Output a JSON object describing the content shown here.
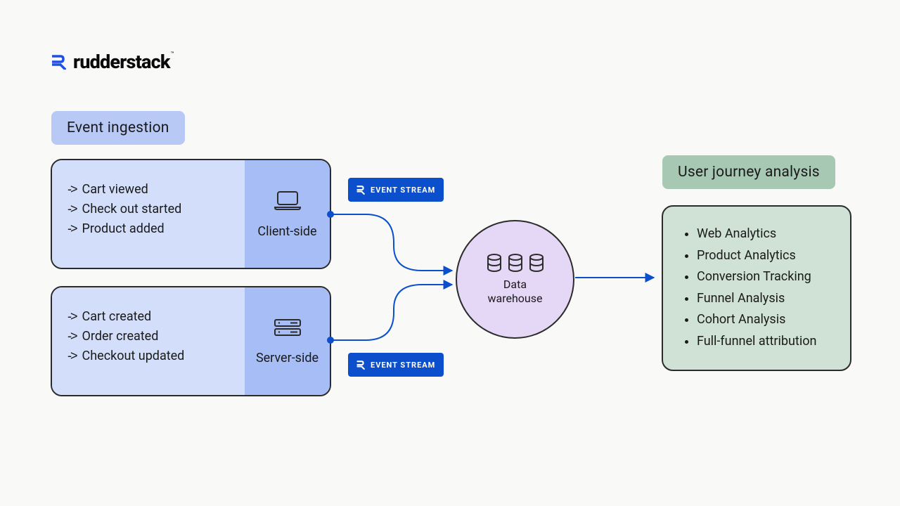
{
  "brand": {
    "name": "rudderstack"
  },
  "ingestion": {
    "title": "Event ingestion",
    "client": {
      "label": "Client-side",
      "events": [
        "Cart viewed",
        "Check out started",
        "Product added"
      ]
    },
    "server": {
      "label": "Server-side",
      "events": [
        "Cart created",
        "Order created",
        "Checkout updated"
      ]
    }
  },
  "stream": {
    "label": "EVENT STREAM"
  },
  "warehouse": {
    "label_l1": "Data",
    "label_l2": "warehouse"
  },
  "analysis": {
    "title": "User journey analysis",
    "items": [
      "Web Analytics",
      "Product Analytics",
      "Conversion Tracking",
      "Funnel Analysis",
      "Cohort Analysis",
      "Full-funnel attribution"
    ]
  }
}
